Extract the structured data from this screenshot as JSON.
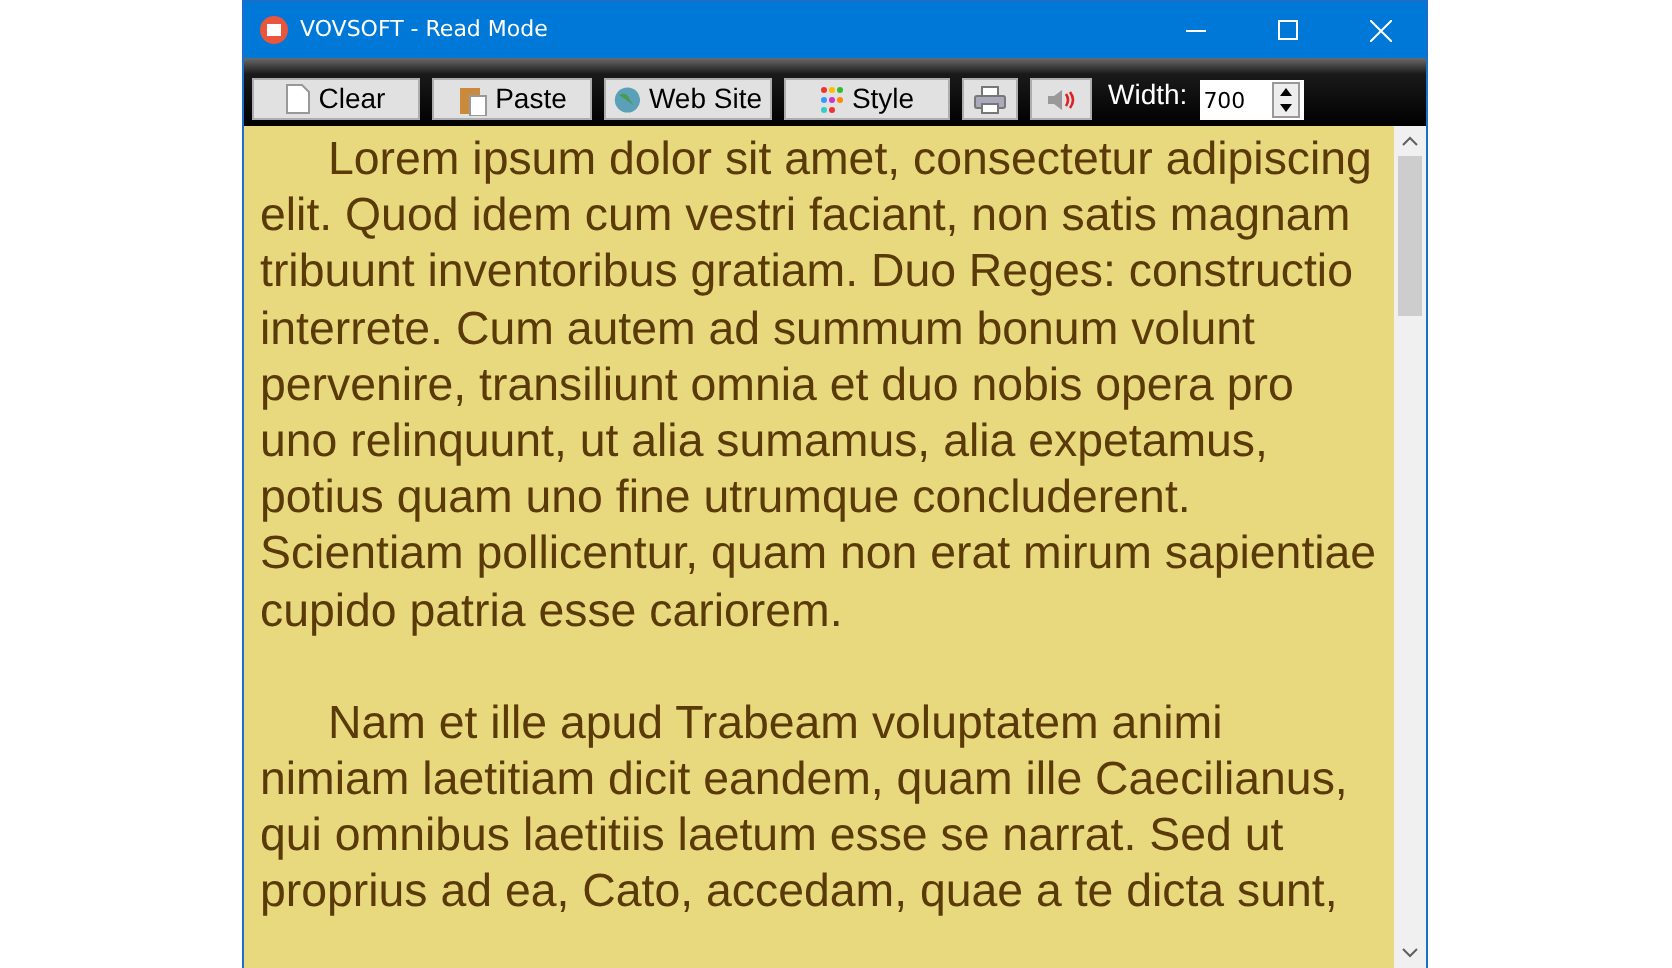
{
  "window": {
    "title": "VOVSOFT - Read Mode"
  },
  "toolbar": {
    "buttons": [
      {
        "kind": "clear",
        "label": "Clear"
      },
      {
        "kind": "paste",
        "label": "Paste"
      },
      {
        "kind": "web",
        "label": "Web Site"
      },
      {
        "kind": "style",
        "label": "Style"
      },
      {
        "kind": "print"
      },
      {
        "kind": "speak"
      }
    ],
    "width_label": "Width:",
    "width_value": "700"
  },
  "paragraphs": [
    "Lorem ipsum dolor sit amet, consectetur adipiscing\nelit. Quod idem cum vestri faciant, non satis magnam\ntribuunt inventoribus gratiam. Duo Reges: constructio\ninterrete. Cum autem ad summum bonum volunt\npervenire, transiliunt omnia et duo nobis opera pro\nuno relinquunt, ut alia sumamus, alia expetamus,\npotius quam uno fine utrumque concluderent.\nScientiam pollicentur, quam non erat mirum sapientiae\ncupido patria esse cariorem.",
    "Nam et ille apud Trabeam voluptatem animi\nnimiam laetitiam dicit eandem, quam ille Caecilianus,\nqui omnibus laetitiis laetum esse se narrat. Sed ut\nproprius ad ea, Cato, accedam, quae a te dicta sunt,"
  ]
}
